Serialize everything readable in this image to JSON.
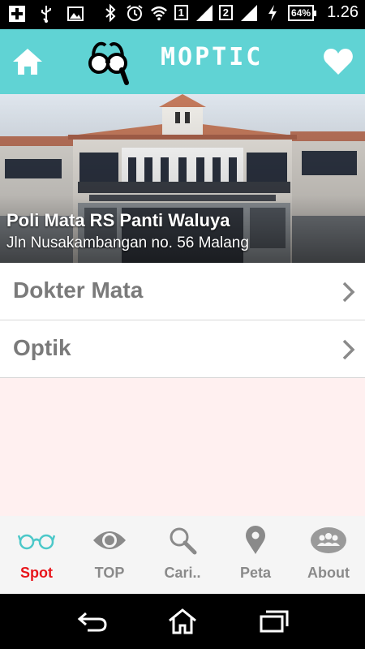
{
  "status_bar": {
    "sim1": "1",
    "sim2": "2",
    "battery": "64%",
    "time": "1.26"
  },
  "app_bar": {
    "title": "MOPTIC"
  },
  "hero": {
    "title": "Poli Mata RS Panti Waluya",
    "subtitle": "Jln Nusakambangan no. 56 Malang"
  },
  "list": [
    {
      "label": "Dokter Mata"
    },
    {
      "label": "Optik"
    }
  ],
  "tabs": [
    {
      "label": "Spot",
      "icon": "glasses-icon",
      "active": true
    },
    {
      "label": "TOP",
      "icon": "eye-icon",
      "active": false
    },
    {
      "label": "Cari..",
      "icon": "search-icon",
      "active": false
    },
    {
      "label": "Peta",
      "icon": "map-pin-icon",
      "active": false
    },
    {
      "label": "About",
      "icon": "people-icon",
      "active": false
    }
  ],
  "colors": {
    "accent": "#60d3d4",
    "active_tab": "#e8161c",
    "list_bg": "#fff0f0"
  }
}
